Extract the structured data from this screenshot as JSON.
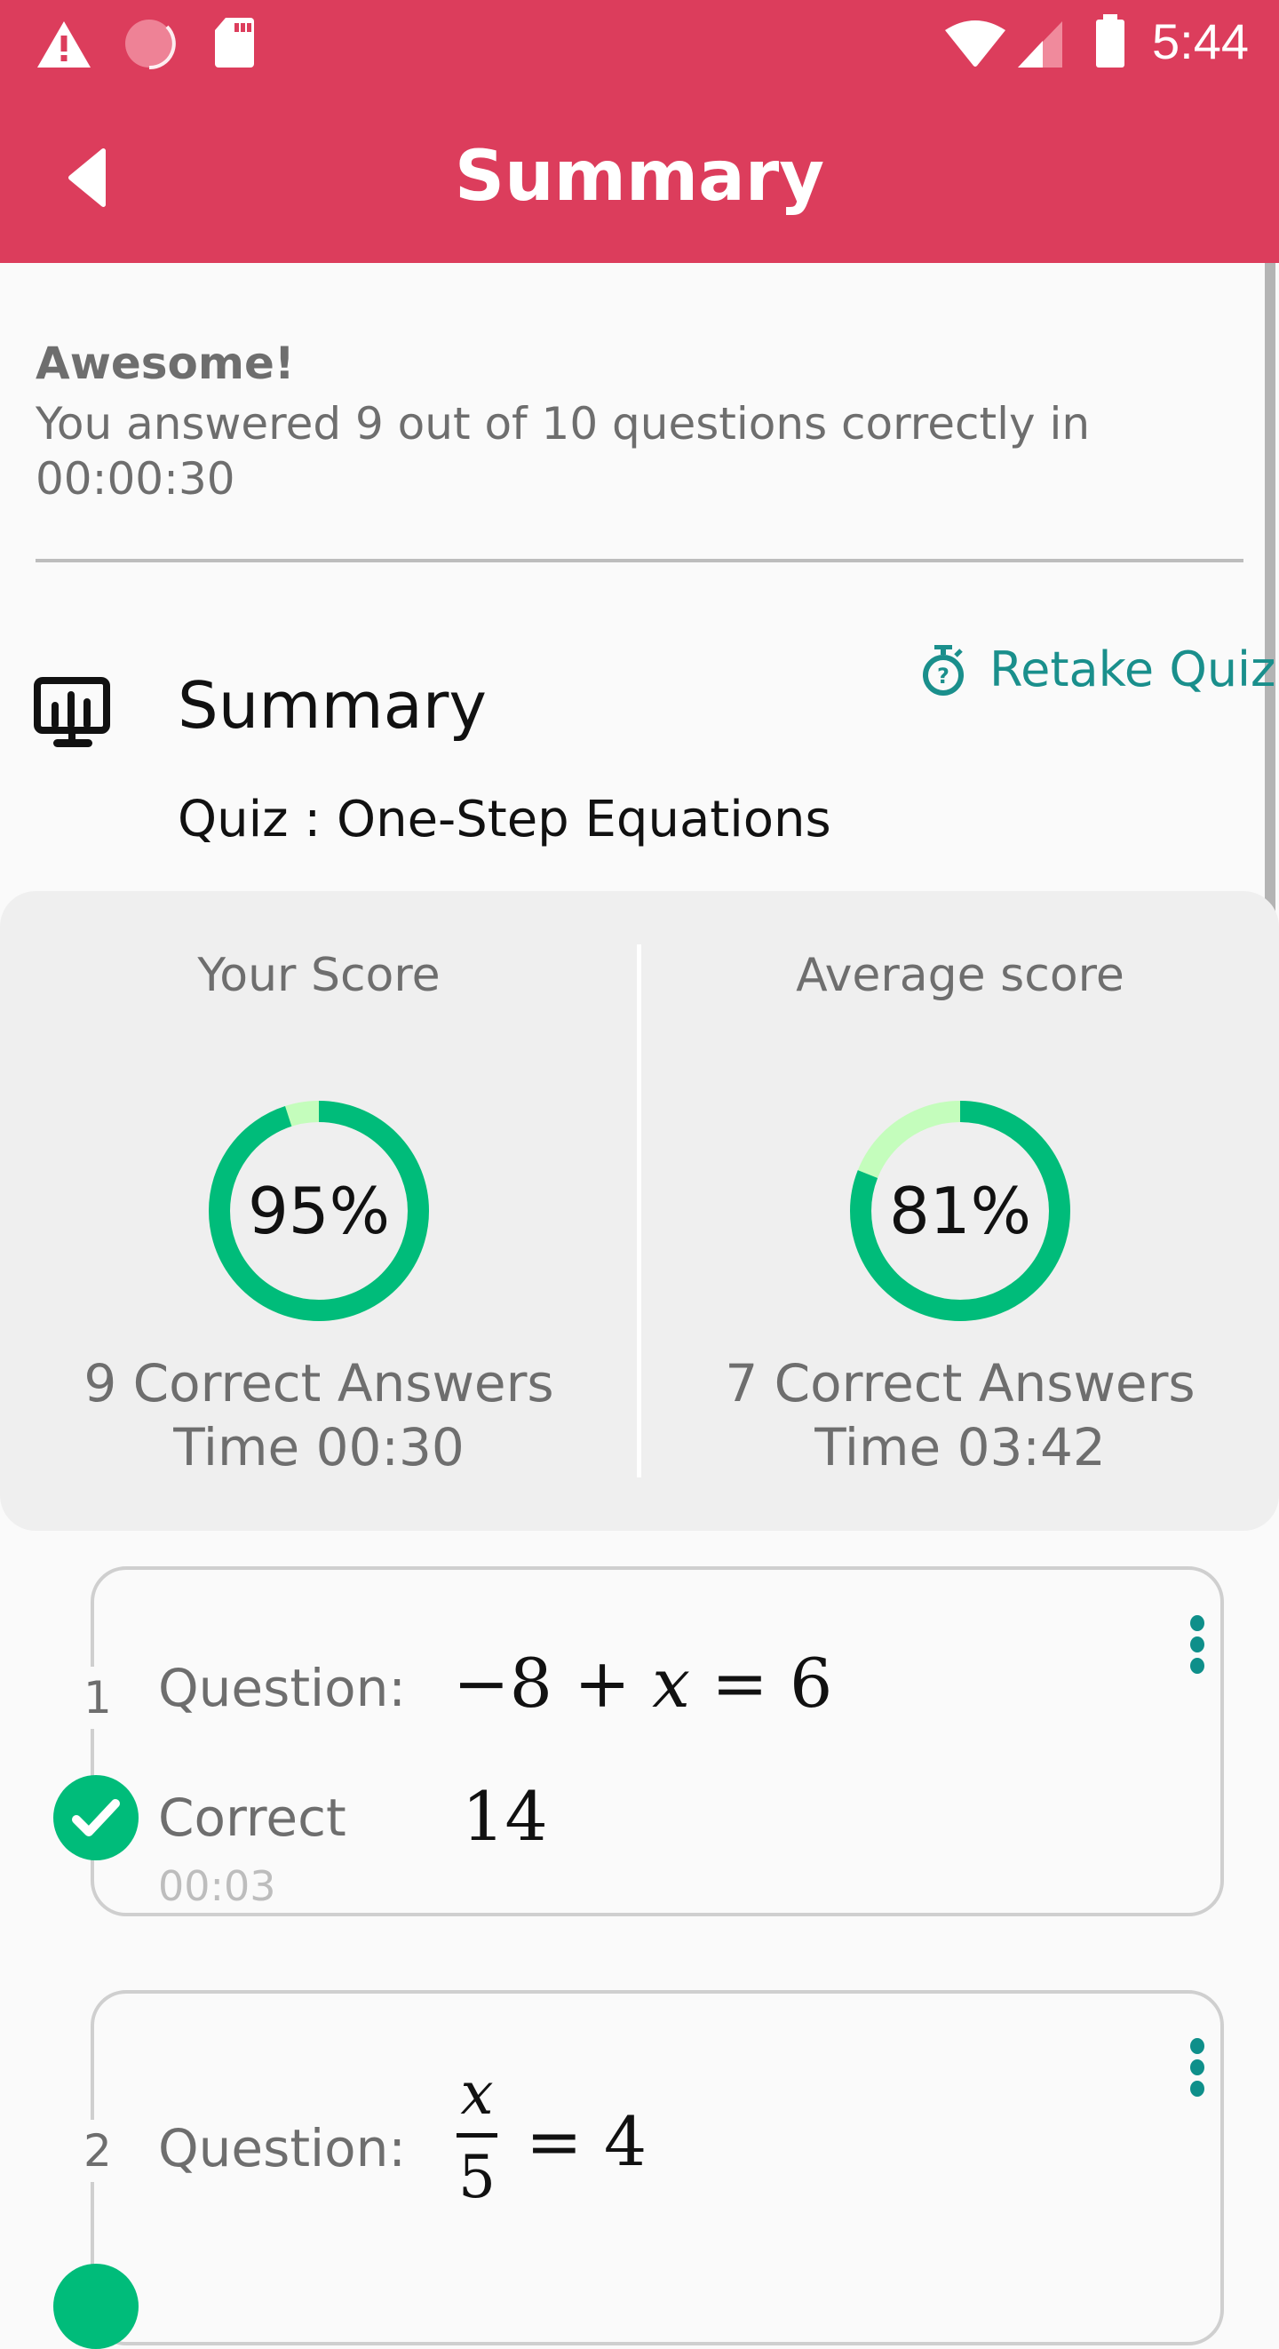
{
  "status_bar": {
    "time": "5:44",
    "left_icons": [
      "warning-icon",
      "loading-circle-icon",
      "sd-card-icon"
    ],
    "right_icons": [
      "wifi-icon",
      "cell-signal-icon",
      "battery-icon"
    ]
  },
  "app_bar": {
    "title": "Summary",
    "back_icon": "back-triangle-icon"
  },
  "result": {
    "headline": "Awesome!",
    "message": "You answered 9 out of 10 questions correctly in 00:00:30"
  },
  "summary": {
    "title": "Summary",
    "quiz_name": "Quiz : One-Step Equations",
    "retake_label": "Retake Quiz",
    "icon": "presentation-chart-icon",
    "retake_icon": "stopwatch-question-icon"
  },
  "scores": {
    "your": {
      "heading": "Your Score",
      "percent": 95,
      "percent_label": "95%",
      "correct_line": "9 Correct Answers",
      "time_line": "Time 00:30"
    },
    "average": {
      "heading": "Average score",
      "percent": 81,
      "percent_label": "81%",
      "correct_line": "7 Correct Answers",
      "time_line": "Time 03:42"
    },
    "colors": {
      "filled": "#00BC7A",
      "remaining": "#C4FDBC"
    }
  },
  "questions": [
    {
      "number": "1",
      "label": "Question:",
      "expression_parts": [
        "−8",
        "+",
        "x",
        "=",
        "6"
      ],
      "status": "Correct",
      "answer": "14",
      "time": "00:03"
    },
    {
      "number": "2",
      "label": "Question:",
      "fraction_numerator": "x",
      "fraction_denominator": "5",
      "rhs": "= 4"
    }
  ],
  "colors": {
    "header": "#DC3D5C",
    "accent_teal": "#1A8F8C",
    "correct_green": "#00BC7A"
  }
}
